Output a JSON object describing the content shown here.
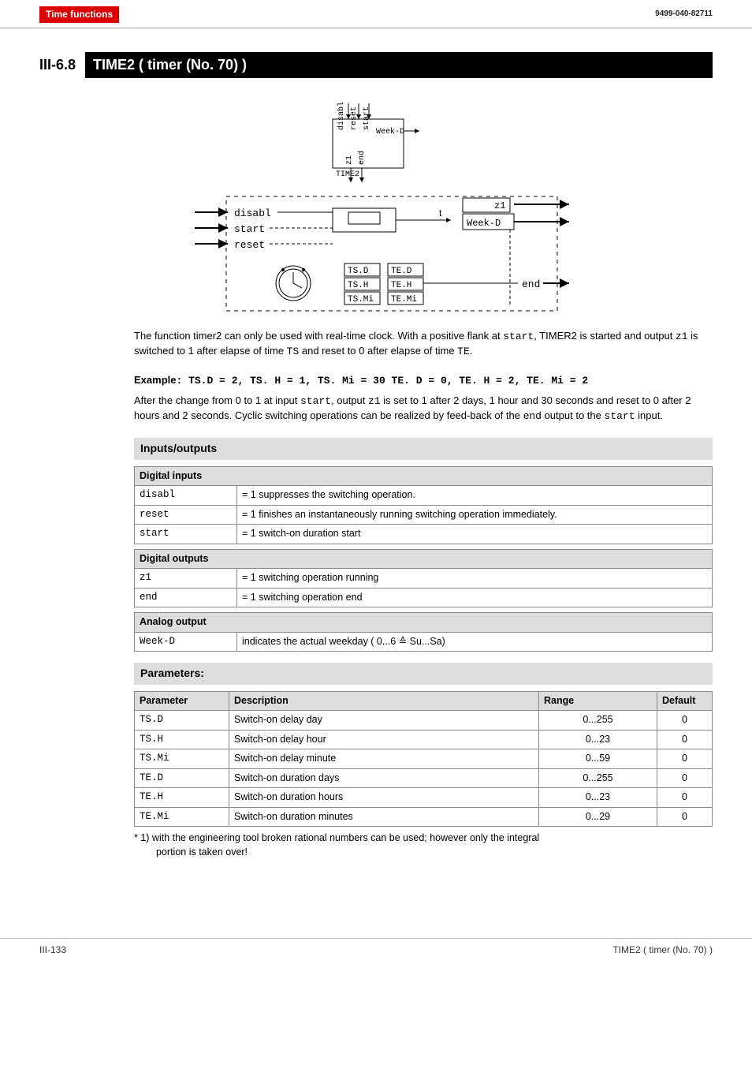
{
  "header": {
    "category": "Time functions",
    "docnum": "9499-040-82711"
  },
  "section": {
    "num": "III-6.8",
    "title": "TIME2 ( timer (No. 70) )"
  },
  "diagram": {
    "block_label": "TIME2",
    "block_top": [
      "disabl",
      "reset",
      "start"
    ],
    "block_right_top": "Week-D",
    "block_bottom": [
      "z1",
      "end"
    ],
    "inputs": [
      "disabl",
      "start",
      "reset"
    ],
    "boxes_row1": [
      "TS.D",
      "TE.D"
    ],
    "boxes_row2": [
      "TS.H",
      "TE.H"
    ],
    "boxes_row3": [
      "TS.Mi",
      "TE.Mi"
    ],
    "out_top": "z1",
    "out_top2": "Week-D",
    "out_right": "end",
    "t_label": "t"
  },
  "intro": {
    "p1a": "The function timer2 can only be used with real-time clock. With a positive flank at ",
    "p1b": ", TIMER2 is started and output ",
    "p1c": " is switched to 1 after elapse of time ",
    "p1d": " and  reset to 0 after elapse of time ",
    "p1e": ".",
    "m1": "start",
    "m2": "z1",
    "m3": "TS",
    "m4": "TE"
  },
  "example": {
    "label": "Example",
    "col": ":",
    "t1": " TS.D = 2, TS. H = 1, TS. Mi = 30  TE. D = 0,  TE. H = 2, TE. Mi = 2",
    "p1a": "After the change from 0 to 1 at input ",
    "p1b": ", output ",
    "p1c": " is set to 1 after 2 days, 1 hour and 30 seconds and reset to 0 after 2 hours and 2 seconds. Cyclic switching operations can be realized by feed-back of the ",
    "p1d": " output to the ",
    "p1e": " input.",
    "m1": "start",
    "m2": "z1",
    "m3": "end",
    "m4": "start"
  },
  "io_head": "Inputs/outputs",
  "tables": {
    "di_head": "Digital inputs",
    "di": [
      {
        "k": "disabl",
        "v": "= 1 suppresses the switching operation."
      },
      {
        "k": "reset",
        "v": "= 1 finishes an instantaneously running switching operation immediately."
      },
      {
        "k": "start",
        "v": "= 1 switch-on duration start"
      }
    ],
    "do_head": "Digital outputs",
    "do": [
      {
        "k": "z1",
        "v": "= 1 switching operation running"
      },
      {
        "k": "end",
        "v": "= 1 switching operation end"
      }
    ],
    "ao_head": "Analog output",
    "ao": [
      {
        "k": "Week-D",
        "v": "indicates the actual weekday ( 0...6 ≙ Su...Sa)"
      }
    ]
  },
  "params_head": "Parameters:",
  "params_cols": {
    "c1": "Parameter",
    "c2": "Description",
    "c3": "Range",
    "c4": "Default"
  },
  "params": [
    {
      "k": "TS.D",
      "d": "Switch-on delay day",
      "r": "0...255",
      "def": "0"
    },
    {
      "k": "TS.H",
      "d": "Switch-on delay hour",
      "r": "0...23",
      "def": "0"
    },
    {
      "k": "TS.Mi",
      "d": "Switch-on delay minute",
      "r": "0...59",
      "def": "0"
    },
    {
      "k": "TE.D",
      "d": "Switch-on duration days",
      "r": "0...255",
      "def": "0"
    },
    {
      "k": "TE.H",
      "d": "Switch-on duration   hours",
      "r": "0...23",
      "def": "0"
    },
    {
      "k": "TE.Mi",
      "d": "Switch-on duration minutes",
      "r": "0...29",
      "def": "0"
    }
  ],
  "footnote": {
    "l1": "* 1) with the engineering tool broken rational numbers can be used; however only the integral",
    "l2": "portion is taken over!"
  },
  "footer": {
    "left": "III-133",
    "right": "TIME2 ( timer (No. 70) )"
  }
}
